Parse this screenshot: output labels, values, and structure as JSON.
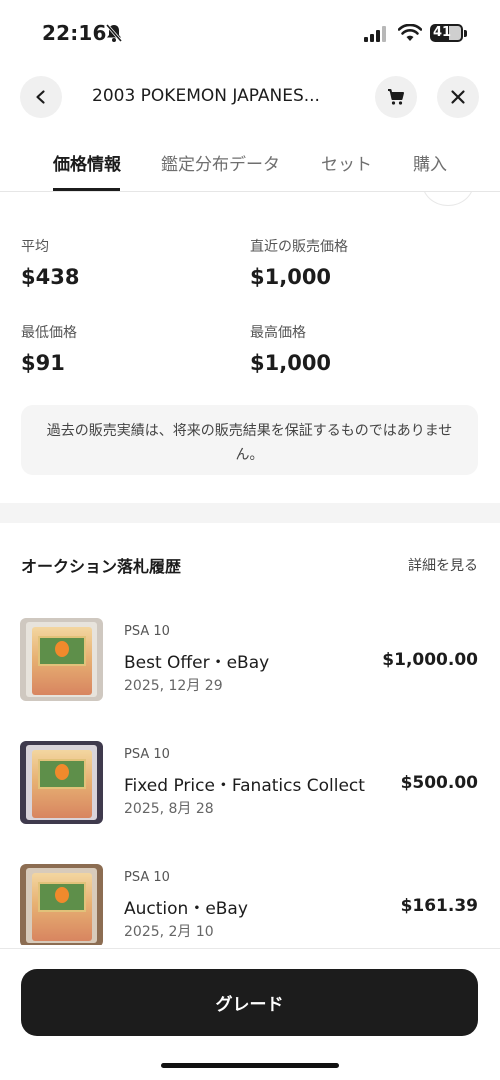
{
  "status_bar": {
    "time": "22:16",
    "battery": "41",
    "icons": [
      "bell-off-icon",
      "signal-icon",
      "wifi-icon",
      "battery-icon"
    ]
  },
  "header": {
    "title": "2003 POKEMON JAPANES...",
    "back_icon": "chevron-left-icon",
    "cart_icon": "cart-icon",
    "close_icon": "close-icon"
  },
  "tabs": [
    {
      "label": "価格情報",
      "active": true
    },
    {
      "label": "鑑定分布データ",
      "active": false
    },
    {
      "label": "セット",
      "active": false
    },
    {
      "label": "購入",
      "active": false
    }
  ],
  "stats": {
    "average_label": "平均",
    "average_value": "$438",
    "recent_label": "直近の販売価格",
    "recent_value": "$1,000",
    "min_label": "最低価格",
    "min_value": "$91",
    "max_label": "最高価格",
    "max_value": "$1,000"
  },
  "disclaimer": "過去の販売実績は、将来の販売結果を保証するものではありません。",
  "auction_history": {
    "title": "オークション落札履歴",
    "see_more": "詳細を見る",
    "items": [
      {
        "grade": "PSA 10",
        "title": "Best Offer・eBay",
        "date": "2025, 12月 29",
        "price": "$1,000.00"
      },
      {
        "grade": "PSA 10",
        "title": "Fixed Price・Fanatics Collect",
        "date": "2025, 8月 28",
        "price": "$500.00"
      },
      {
        "grade": "PSA 10",
        "title": "Auction・eBay",
        "date": "2025, 2月 10",
        "price": "$161.39"
      }
    ]
  },
  "grade_button": "グレード",
  "colors": {
    "primary_dark": "#1c1c1c",
    "muted_text": "#6f6f6f",
    "light_bg": "#f5f5f5"
  }
}
